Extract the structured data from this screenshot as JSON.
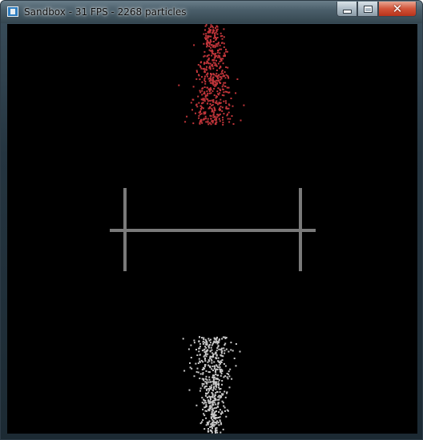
{
  "window": {
    "title": "Sandbox - 31 FPS - 2268 particles",
    "app_icon": "window-icon",
    "controls": {
      "minimize_icon": "minimize-icon",
      "maximize_icon": "maximize-icon",
      "close_icon": "close-icon",
      "close_glyph": "✕"
    }
  },
  "scene": {
    "background_color": "#000000",
    "barrier_color": "#7a7a7a",
    "red_particle_color": "#c0353a",
    "white_particle_color": "#c9c9c9"
  }
}
